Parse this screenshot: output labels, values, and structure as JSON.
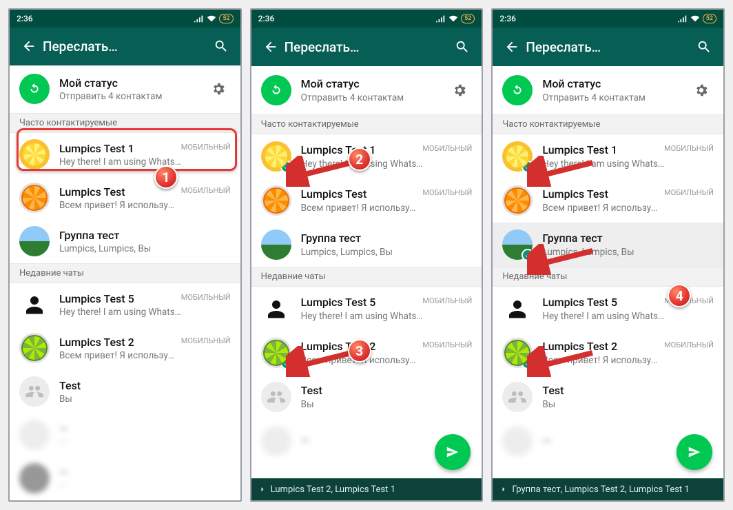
{
  "status": {
    "time": "2:36",
    "battery": "52"
  },
  "header": {
    "title": "Переслать…"
  },
  "myStatus": {
    "title": "Мой статус",
    "subtitle": "Отправить 4 контактам"
  },
  "sections": {
    "frequent": "Часто контактируемые",
    "recent": "Недавние чаты"
  },
  "mobile_tag": "МОБИЛЬНЫЙ",
  "contacts": {
    "t1": {
      "name": "Lumpics Test 1",
      "sub": "Hey there! I am using WhatsApp."
    },
    "t": {
      "name": "Lumpics Test",
      "sub": "Всем привет! Я использую WhatsApp."
    },
    "grp": {
      "name": "Группа тест",
      "sub": "Lumpics, Lumpics, Вы"
    },
    "t5": {
      "name": "Lumpics Test 5",
      "sub": "Hey there! I am using WhatsApp."
    },
    "t2": {
      "name": "Lumpics Test 2",
      "sub": "Всем привет! Я использую WhatsApp."
    },
    "test": {
      "name": "Test",
      "sub": "Вы"
    }
  },
  "selbar": {
    "s2": "Lumpics Test 2, Lumpics Test 1",
    "s3": "Группа тест, Lumpics Test 2, Lumpics Test 1"
  },
  "annotations": {
    "b1": "1",
    "b2": "2",
    "b3": "3",
    "b4": "4"
  }
}
